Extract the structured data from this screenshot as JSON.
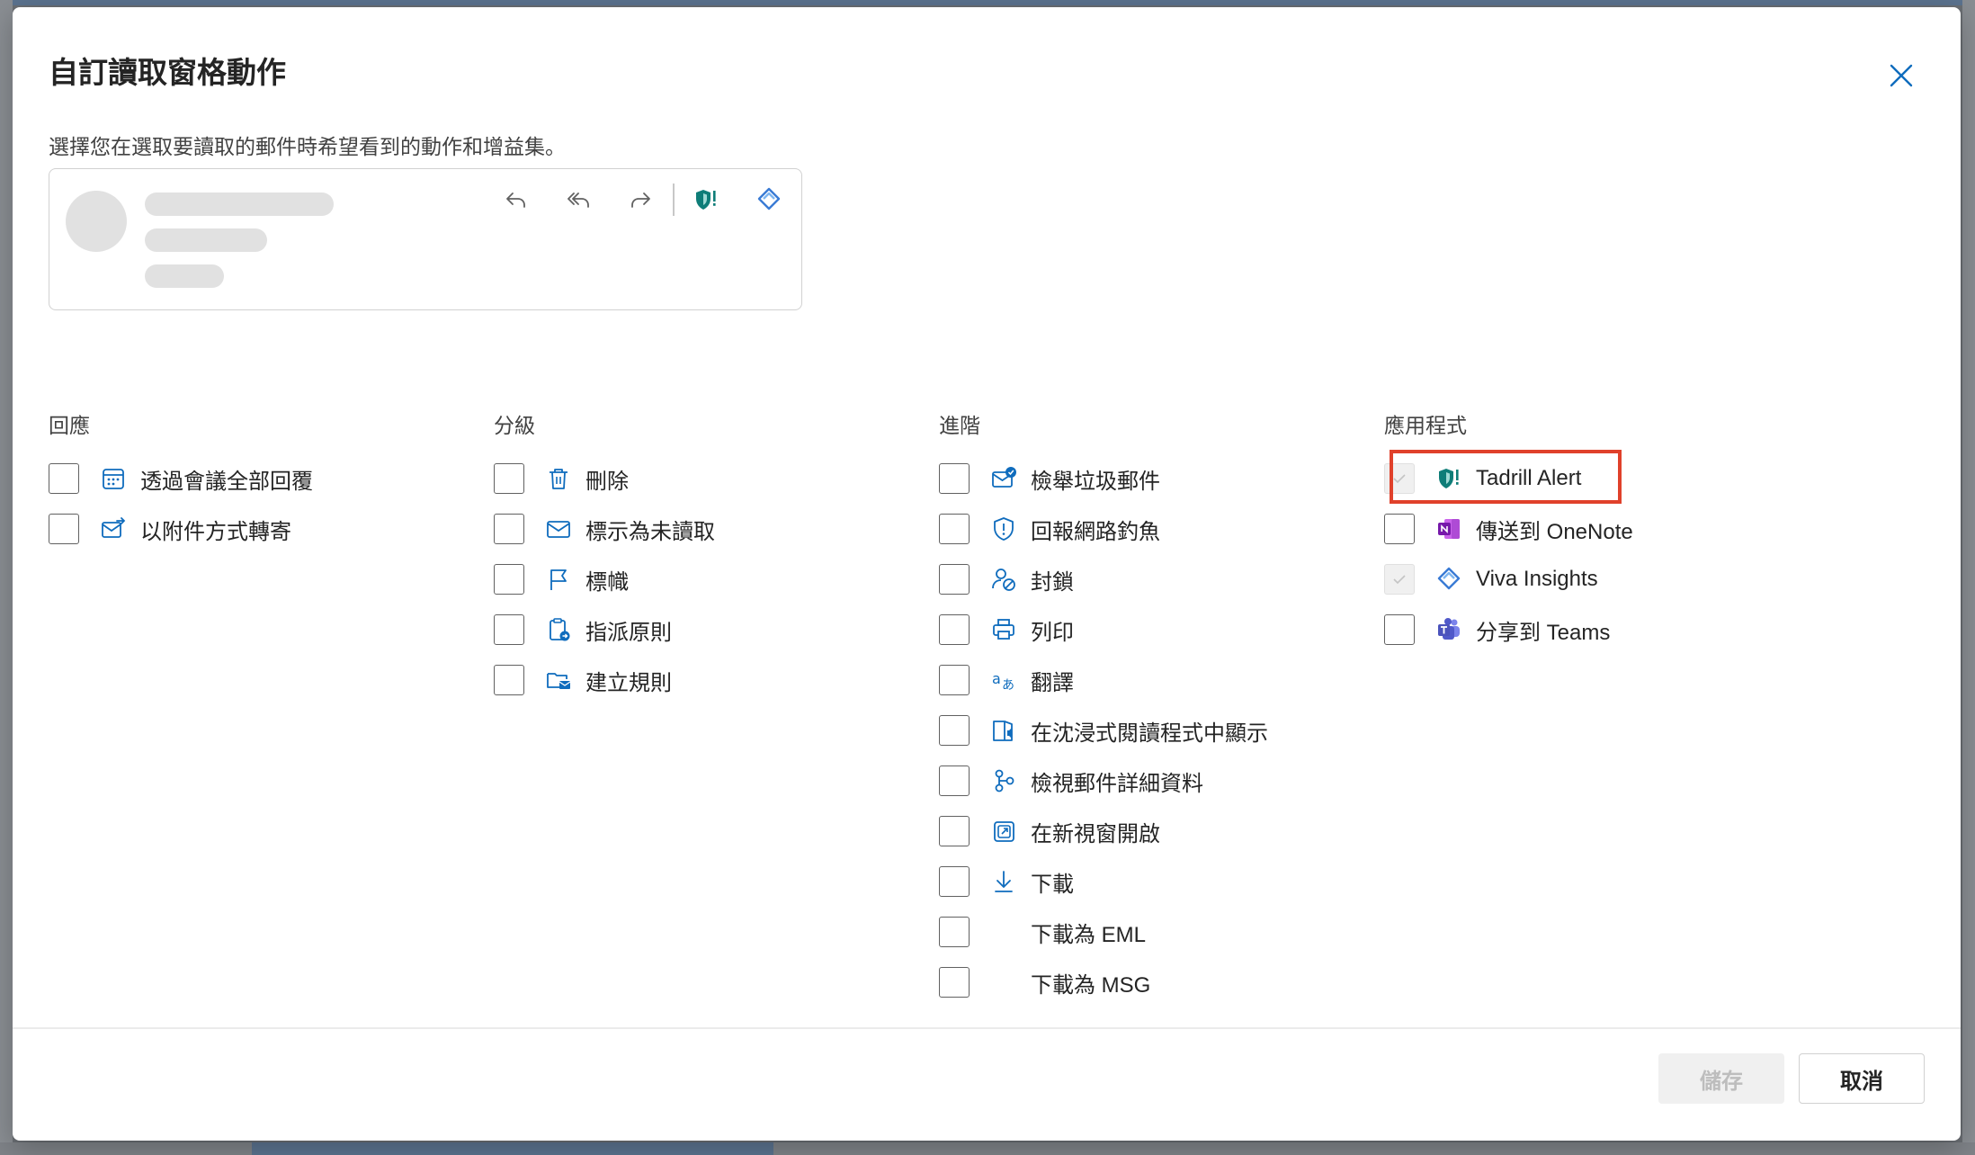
{
  "dialog": {
    "title": "自訂讀取窗格動作",
    "subtitle": "選擇您在選取要讀取的郵件時希望看到的動作和增益集。",
    "close_icon": "close-icon"
  },
  "preview": {
    "toolbar_icons": [
      "reply-icon",
      "reply-all-icon",
      "forward-icon",
      "tadrill-shield-icon",
      "viva-insights-icon"
    ]
  },
  "columns": {
    "respond": {
      "heading": "回應",
      "items": [
        {
          "label": "透過會議全部回覆",
          "icon": "calendar-icon",
          "checked": false
        },
        {
          "label": "以附件方式轉寄",
          "icon": "mail-forward-attachment-icon",
          "checked": false
        }
      ]
    },
    "triage": {
      "heading": "分級",
      "items": [
        {
          "label": "刪除",
          "icon": "trash-icon",
          "checked": false
        },
        {
          "label": "標示為未讀取",
          "icon": "envelope-icon",
          "checked": false
        },
        {
          "label": "標幟",
          "icon": "flag-icon",
          "checked": false
        },
        {
          "label": "指派原則",
          "icon": "clipboard-policy-icon",
          "checked": false
        },
        {
          "label": "建立規則",
          "icon": "folder-mail-icon",
          "checked": false
        }
      ]
    },
    "advanced": {
      "heading": "進階",
      "items": [
        {
          "label": "檢舉垃圾郵件",
          "icon": "report-junk-icon",
          "checked": false
        },
        {
          "label": "回報網路釣魚",
          "icon": "shield-alert-icon",
          "checked": false
        },
        {
          "label": "封鎖",
          "icon": "block-user-icon",
          "checked": false
        },
        {
          "label": "列印",
          "icon": "print-icon",
          "checked": false
        },
        {
          "label": "翻譯",
          "icon": "translate-icon",
          "checked": false
        },
        {
          "label": "在沈浸式閱讀程式中顯示",
          "icon": "immersive-reader-icon",
          "checked": false
        },
        {
          "label": "檢視郵件詳細資料",
          "icon": "message-details-icon",
          "checked": false
        },
        {
          "label": "在新視窗開啟",
          "icon": "open-new-window-icon",
          "checked": false
        },
        {
          "label": "下載",
          "icon": "download-icon",
          "checked": false
        },
        {
          "label": "下載為 EML",
          "icon": "",
          "checked": false
        },
        {
          "label": "下載為 MSG",
          "icon": "",
          "checked": false
        }
      ]
    },
    "apps": {
      "heading": "應用程式",
      "items": [
        {
          "label": "Tadrill Alert",
          "icon": "tadrill-shield-icon",
          "checked": true,
          "disabled": true
        },
        {
          "label": "傳送到 OneNote",
          "icon": "onenote-icon",
          "checked": false
        },
        {
          "label": "Viva Insights",
          "icon": "viva-insights-icon",
          "checked": true,
          "disabled": true
        },
        {
          "label": "分享到 Teams",
          "icon": "teams-icon",
          "checked": false
        }
      ]
    }
  },
  "footer": {
    "save_label": "儲存",
    "cancel_label": "取消"
  },
  "colors": {
    "accent": "#0f6cbd",
    "highlight": "#e0412b",
    "tadrill": "#0e7d78",
    "onenote": "#7719aa",
    "teams": "#5059c9"
  }
}
